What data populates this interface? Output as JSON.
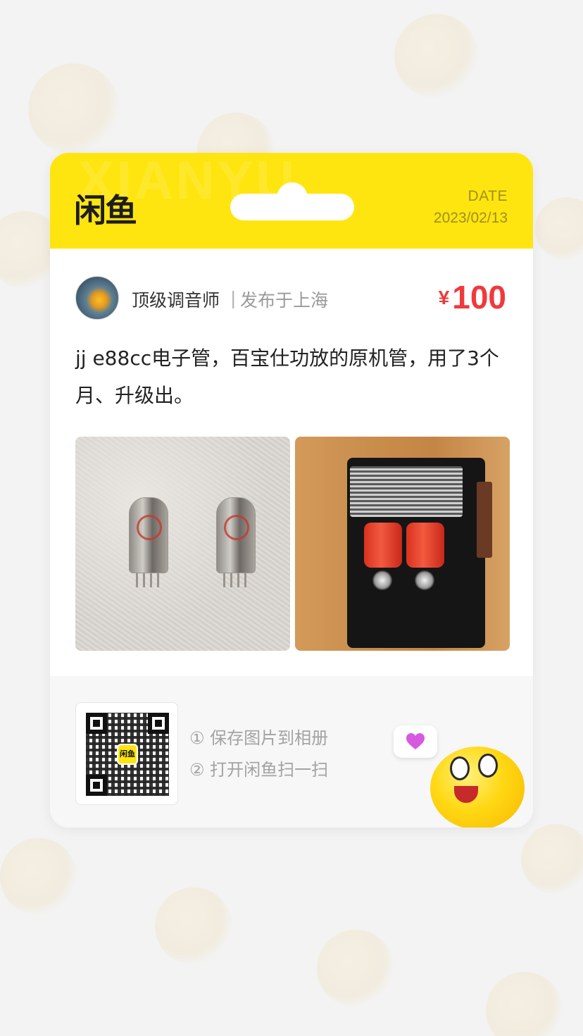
{
  "header": {
    "logo_text": "闲鱼",
    "watermark_text": "XIANYU",
    "date_label": "DATE",
    "date_value": "2023/02/13"
  },
  "seller": {
    "name": "顶级调音师",
    "separator": "|",
    "location": "发布于上海"
  },
  "price": {
    "currency": "¥",
    "amount": "100"
  },
  "description": "jj e88cc电子管，百宝仕功放的原机管，用了3个月、升级出。",
  "footer": {
    "qr_logo_text": "闲鱼",
    "step_1": "① 保存图片到相册",
    "step_2": "② 打开闲鱼扫一扫"
  },
  "colors": {
    "brand_yellow": "#ffe50f",
    "price_red": "#f0393c"
  },
  "icons": [
    "qr-code-icon",
    "heart-bubble-icon",
    "mascot-icon"
  ]
}
